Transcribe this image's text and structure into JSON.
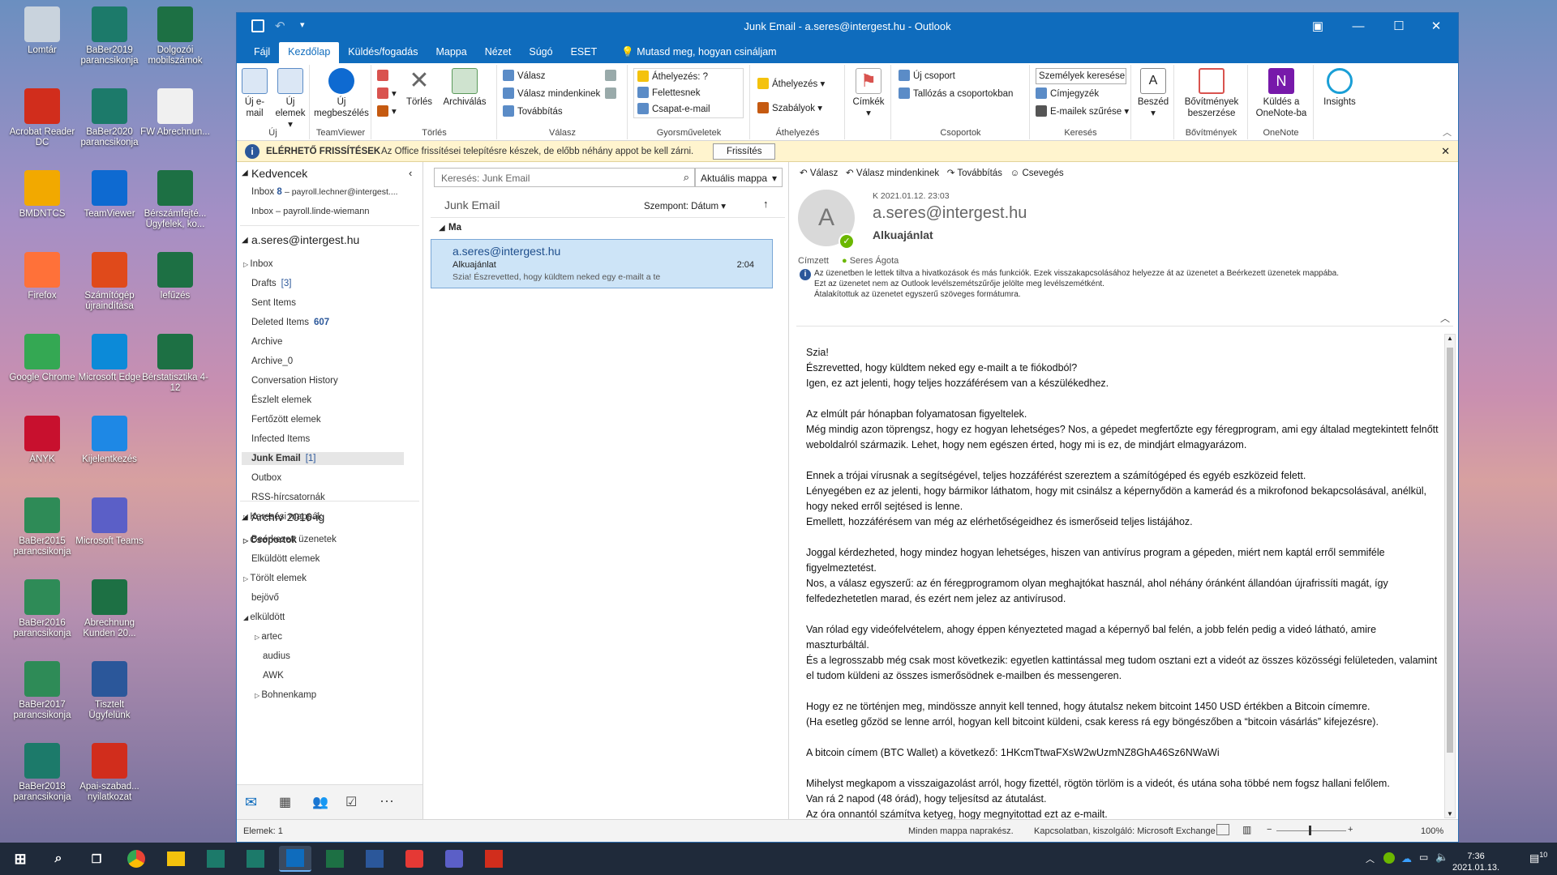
{
  "desktop": {
    "icons": [
      {
        "label": "Lomtár",
        "color": "#c9d3dd"
      },
      {
        "label": "BaBer2019 parancsikonja",
        "color": "#1c7a6a"
      },
      {
        "label": "Dolgozói mobilszámok",
        "color": "#1d7044"
      },
      {
        "label": "Acrobat Reader DC",
        "color": "#d12d1c"
      },
      {
        "label": "BaBer2020 parancsikonja",
        "color": "#1c7a6a"
      },
      {
        "label": "FW Abrechnun...",
        "color": "#f0f0f0"
      },
      {
        "label": "BMDNTCS",
        "color": "#f2a900"
      },
      {
        "label": "TeamViewer",
        "color": "#0e6ad1"
      },
      {
        "label": "Bérszámfejté... Ügyfelek, ko...",
        "color": "#1d7044"
      },
      {
        "label": "Firefox",
        "color": "#ff7139"
      },
      {
        "label": "Számítógép újraindítása",
        "color": "#e04a1b"
      },
      {
        "label": "lefűzés",
        "color": "#1d7044"
      },
      {
        "label": "Google Chrome",
        "color": "#34a853"
      },
      {
        "label": "Microsoft Edge",
        "color": "#0c8ad8"
      },
      {
        "label": "Bérstatisztika 4-12",
        "color": "#1d7044"
      },
      {
        "label": "ÁNYK",
        "color": "#c8102e"
      },
      {
        "label": "Kijelentkezés",
        "color": "#1e88e5"
      },
      {
        "label": "BaBer2015 parancsikonja",
        "color": "#2e8b57"
      },
      {
        "label": "Microsoft Teams",
        "color": "#5b5fc7"
      },
      {
        "label": "BaBer2016 parancsikonja",
        "color": "#2e8b57"
      },
      {
        "label": "Abrechnung Kunden 20...",
        "color": "#1d7044"
      },
      {
        "label": "BaBer2017 parancsikonja",
        "color": "#2e8b57"
      },
      {
        "label": "Tisztelt Ügyfelünk",
        "color": "#2b579a"
      },
      {
        "label": "BaBer2018 parancsikonja",
        "color": "#1c7a6a"
      },
      {
        "label": "Apai-szabad... nyilatkozat",
        "color": "#d12d1c"
      }
    ]
  },
  "window": {
    "title": "Junk Email - a.seres@intergest.hu  -  Outlook"
  },
  "menu": [
    "Fájl",
    "Kezdőlap",
    "Küldés/fogadás",
    "Mappa",
    "Nézet",
    "Súgó",
    "ESET"
  ],
  "tellme": "Mutasd meg, hogyan csináljam",
  "ribbon": {
    "new_email": "Új e-mail",
    "new_items": "Új elemek",
    "grp_new": "Új",
    "new_meeting": "Új megbeszélés",
    "grp_teamviewer": "TeamViewer",
    "delete": "Törlés",
    "archive": "Archiválás",
    "grp_delete": "Törlés",
    "reply": "Válasz",
    "reply_all": "Válasz mindenkinek",
    "forward": "Továbbítás",
    "grp_reply": "Válasz",
    "qs1": "Áthelyezés: ?",
    "qs2": "Felettesnek",
    "qs3": "Csapat-e-mail",
    "grp_quick": "Gyorsműveletek",
    "move": "Áthelyezés",
    "rules": "Szabályok",
    "grp_move": "Áthelyezés",
    "tags": "Címkék",
    "new_group": "Új csoport",
    "browse_groups": "Tallózás a csoportokban",
    "grp_groups": "Csoportok",
    "search_people": "Személyek keresése",
    "address_book": "Címjegyzék",
    "filter_email": "E-mailek szűrése",
    "grp_find": "Keresés",
    "speech": "Beszéd",
    "get_addins": "Bővítmények beszerzése",
    "grp_addins": "Bővítmények",
    "send_onenote": "Küldés a OneNote-ba",
    "grp_onenote": "OneNote",
    "insights": "Insights"
  },
  "infobar": {
    "title": "ELÉRHETŐ FRISSÍTÉSEK",
    "text": "Az Office frissítései telepítésre készek, de előbb néhány appot be kell zárni.",
    "button": "Frissítés"
  },
  "nav": {
    "favorites": "Kedvencek",
    "fav_inbox1": "Inbox",
    "fav_inbox1_count": "8",
    "fav_inbox1_acct": "– payroll.lechner@intergest....",
    "fav_inbox2": "Inbox – payroll.linde-wiemann",
    "account": "a.seres@intergest.hu",
    "folders": [
      {
        "name": "Inbox",
        "count": ""
      },
      {
        "name": "Drafts",
        "count": "[3]"
      },
      {
        "name": "Sent Items",
        "count": ""
      },
      {
        "name": "Deleted Items",
        "count": "607"
      },
      {
        "name": "Archive",
        "count": ""
      },
      {
        "name": "Archive_0",
        "count": ""
      },
      {
        "name": "Conversation History",
        "count": ""
      },
      {
        "name": "Észlelt elemek",
        "count": ""
      },
      {
        "name": "Fertőzött elemek",
        "count": ""
      },
      {
        "name": "Infected Items",
        "count": ""
      },
      {
        "name": "Junk Email",
        "count": "[1]"
      },
      {
        "name": "Outbox",
        "count": ""
      },
      {
        "name": "RSS-hírcsatornák",
        "count": ""
      },
      {
        "name": "Keresési mappák",
        "count": ""
      }
    ],
    "groups": "Csoportok",
    "archive_title": "Archív 2016-ig",
    "archive_folders": [
      "Beérkezett üzenetek",
      "Elküldött elemek",
      "Törölt elemek",
      "bejövő",
      "elküldött",
      "artec",
      "audius",
      "AWK",
      "Bohnenkamp"
    ]
  },
  "list": {
    "search_placeholder": "Keresés: Junk Email",
    "scope": "Aktuális mappa",
    "folder": "Junk Email",
    "sort": "Szempont: Dátum",
    "group": "Ma",
    "items": [
      {
        "from": "a.seres@intergest.hu",
        "subject": "Alkuajánlat",
        "preview": "Szia!  Észrevetted, hogy küldtem neked egy e-mailt a te",
        "time": "2:04"
      }
    ]
  },
  "reading": {
    "actions": [
      "Válasz",
      "Válasz mindenkinek",
      "Továbbítás",
      "Csevegés"
    ],
    "date": "K 2021.01.12. 23:03",
    "from": "a.seres@intergest.hu",
    "subject": "Alkuajánlat",
    "avatar": "A",
    "to_label": "Címzett",
    "to": "Seres Ágota",
    "notice1": "Az üzenetben le lettek tiltva a hivatkozások és más funkciók. Ezek visszakapcsolásához helyezze át az üzenetet a Beérkezett üzenetek mappába.",
    "notice2": "Ezt az üzenetet nem az Outlook levélszemétszűrője jelölte meg levélszemétként.",
    "notice3": "Átalakítottuk az üzenetet egyszerű szöveges formátumra.",
    "body": [
      "Szia!",
      "Észrevetted, hogy küldtem neked egy e-mailt a te fiókodból?",
      "Igen, ez azt jelenti, hogy teljes hozzáférésem van a készülékedhez.",
      "",
      "Az elmúlt pár hónapban folyamatosan figyeltelek.",
      "Még mindig azon töprengsz, hogy ez hogyan lehetséges? Nos, a gépedet megfertőzte egy féregprogram, ami egy általad megtekintett felnőtt weboldalról származik. Lehet, hogy nem egészen érted, hogy mi is ez, de mindjárt elmagyarázom.",
      "",
      "Ennek a trójai vírusnak a segítségével, teljes hozzáférést szereztem a számítógéped és egyéb eszközeid felett.",
      "Lényegében ez az jelenti, hogy bármikor láthatom, hogy mit csinálsz a képernyődön a kamerád és a mikrofonod bekapcsolásával, anélkül, hogy neked erről sejtésed is lenne.",
      "Emellett, hozzáférésem van még az elérhetőségeidhez és ismerőseid teljes listájához.",
      "",
      "Joggal kérdezheted, hogy mindez hogyan lehetséges, hiszen van antivírus program a gépeden, miért nem kaptál erről semmiféle figyelmeztetést.",
      "Nos, a válasz egyszerű: az én féregprogramom olyan meghajtókat használ, ahol néhány óránként állandóan újrafrissíti magát, így felfedezhetetlen marad, és ezért nem jelez az antivírusod.",
      "",
      "Van rólad egy videófelvételem, ahogy éppen kényezteted magad a képernyő bal felén, a jobb felén pedig a videó látható, amire maszturbáltál.",
      "És a legrosszabb még csak most következik: egyetlen kattintással meg tudom osztani ezt a videót az összes közösségi felületeden, valamint el tudom küldeni az összes ismerősödnek e-mailben és messengeren.",
      "",
      "Hogy ez ne történjen meg, mindössze annyit kell tenned, hogy átutalsz nekem bitcoint 1450 USD értékben a Bitcoin címemre.",
      "(Ha esetleg gőzöd se lenne arról, hogyan kell bitcoint küldeni, csak keress rá egy böngészőben a “bitcoin vásárlás” kifejezésre).",
      "",
      "A bitcoin címem (BTC Wallet) a következő: 1HKcmTtwaFXsW2wUzmNZ8GhA46Sz6NWaWi",
      "",
      "Mihelyst megkapom a visszaigazolást arról, hogy fizettél, rögtön törlöm is a videót, és utána soha többé nem fogsz hallani felőlem.",
      "Van rá 2 napod (48 órád), hogy teljesítsd az átutalást.",
      "Az óra onnantól számítva ketyeg, hogy megnyitottad ezt az e-mailt."
    ]
  },
  "status": {
    "items": "Elemek: 1",
    "sync": "Minden mappa naprakész.",
    "conn": "Kapcsolatban, kiszolgáló: Microsoft Exchange",
    "zoom": "100%"
  },
  "taskbar": {
    "time": "7:36",
    "date": "2021.01.13.",
    "notif": "10"
  }
}
